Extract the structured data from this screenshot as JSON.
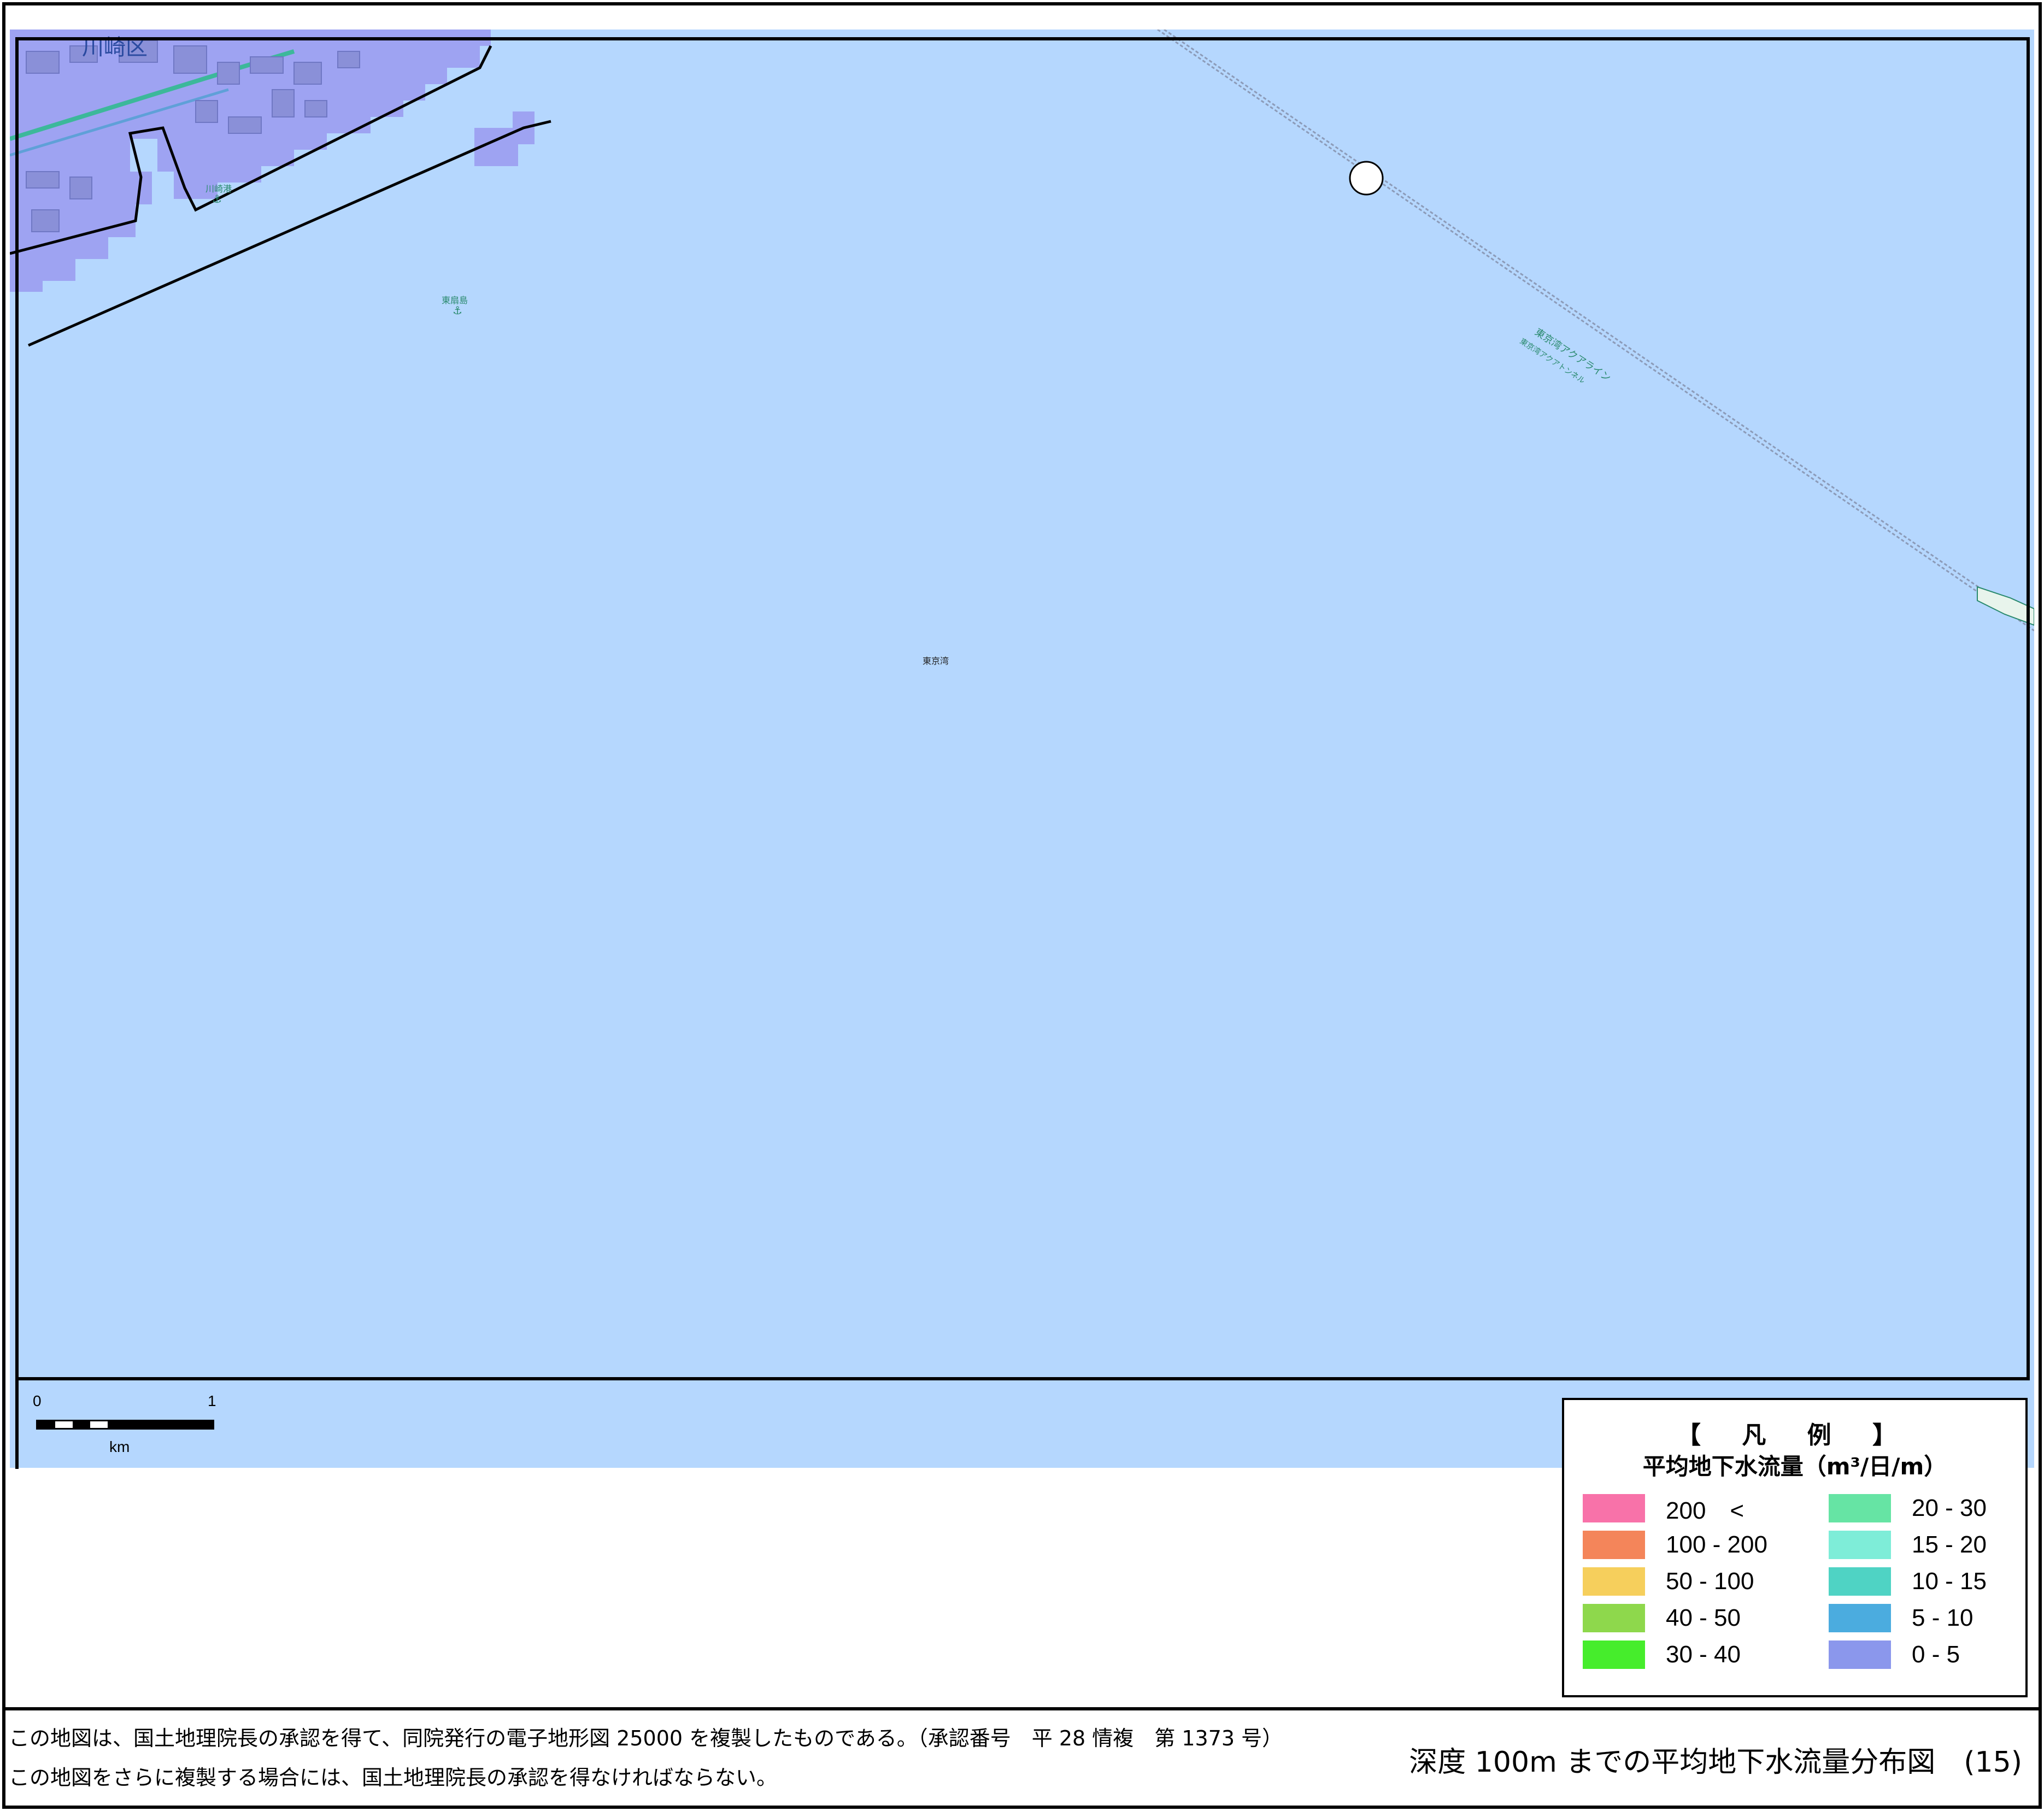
{
  "map": {
    "water_color": "#b5d7fe",
    "land_color": "#9ea3f2",
    "labels": {
      "ward": "川崎区",
      "port": "川崎港",
      "port2": "東扇島",
      "bay": "東京湾",
      "aqualine": "東京湾アクアライン",
      "aqualine_tunnel": "東京湾アクアトンネル"
    },
    "icons": [
      "anchor-icon",
      "ventilation-island-icon",
      "ship-icon"
    ]
  },
  "scale": {
    "zero": "0",
    "one": "1",
    "unit": "km"
  },
  "legend": {
    "title": "【 凡 例 】",
    "subtitle": "平均地下水流量（m³/日/m）",
    "items": [
      {
        "label": "200　<",
        "color": "#f872a9"
      },
      {
        "label": "100 - 200",
        "color": "#f4855a"
      },
      {
        "label": "50 - 100",
        "color": "#f6cf5c"
      },
      {
        "label": "40 - 50",
        "color": "#8ed84c"
      },
      {
        "label": "30 - 40",
        "color": "#46ed2c"
      },
      {
        "label": "20 - 30",
        "color": "#66e4a4"
      },
      {
        "label": "15 - 20",
        "color": "#7eedd8"
      },
      {
        "label": "10 - 15",
        "color": "#4fd3c4"
      },
      {
        "label": "5 - 10",
        "color": "#4bacdf"
      },
      {
        "label": "0 - 5",
        "color": "#8b97ec"
      }
    ]
  },
  "footer": {
    "note1": "この地図は、国土地理院長の承認を得て、同院発行の電子地形図 25000 を複製したものである。（承認番号　平 28 情複　第 1373 号）",
    "note2": "この地図をさらに複製する場合には、国土地理院長の承認を得なければならない。",
    "title": "深度 100m までの平均地下水流量分布図　(15)"
  }
}
